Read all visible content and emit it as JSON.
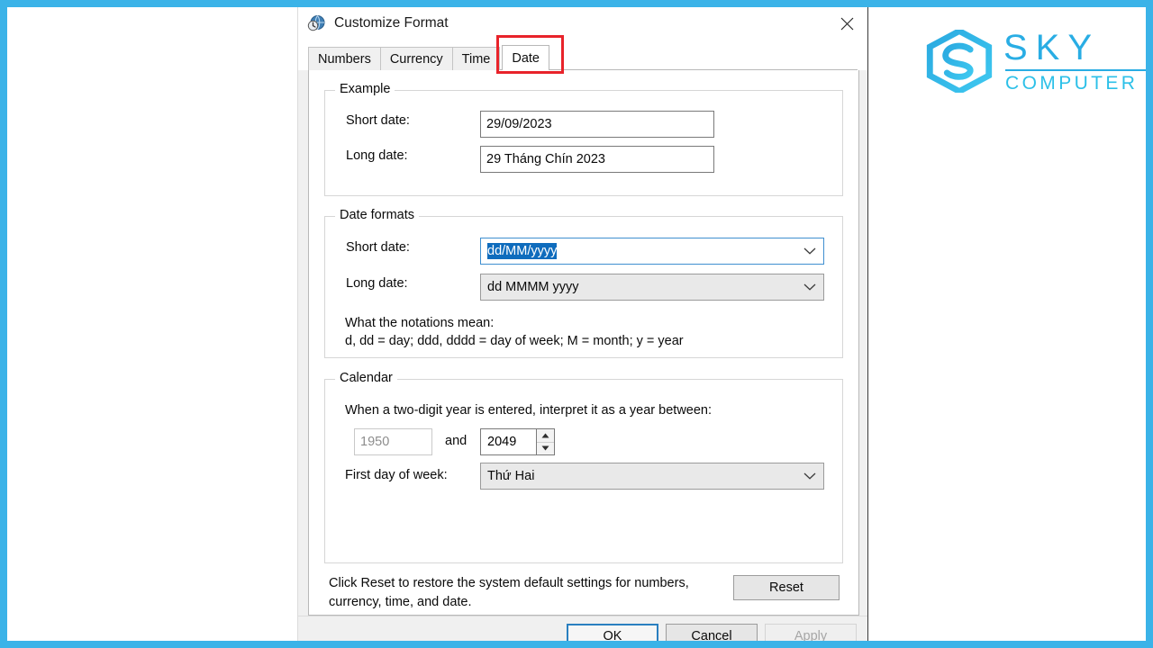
{
  "frame": {
    "accent_color": "#3bb3e8"
  },
  "logo": {
    "brand_top": "SKY",
    "brand_bottom": "COMPUTER",
    "color_primary": "#29ade4",
    "color_secondary": "#2cc0e8"
  },
  "dialog": {
    "title": "Customize Format",
    "icon": "region-globe-clock-icon",
    "close_label": "✕",
    "tabs": [
      {
        "label": "Numbers",
        "active": false
      },
      {
        "label": "Currency",
        "active": false
      },
      {
        "label": "Time",
        "active": false
      },
      {
        "label": "Date",
        "active": true,
        "highlight_color": "#e8232a"
      }
    ]
  },
  "example": {
    "group_title": "Example",
    "short_date_label": "Short date:",
    "short_date_value": "29/09/2023",
    "long_date_label": "Long date:",
    "long_date_value": "29 Tháng Chín 2023"
  },
  "date_formats": {
    "group_title": "Date formats",
    "short_date_label": "Short date:",
    "short_date_value": "dd/MM/yyyy",
    "short_date_selected": true,
    "long_date_label": "Long date:",
    "long_date_value": "dd MMMM yyyy",
    "notations_heading": "What the notations mean:",
    "notations_line": "d, dd = day;  ddd, dddd = day of week;  M = month;  y = year"
  },
  "calendar": {
    "group_title": "Calendar",
    "two_digit_label": "When a two-digit year is entered, interpret it as a year between:",
    "year_from": "1950",
    "and_label": "and",
    "year_to": "2049",
    "first_day_label": "First day of week:",
    "first_day_value": "Thứ Hai"
  },
  "reset": {
    "description": "Click Reset to restore the system default settings for numbers, currency, time, and date.",
    "button_label": "Reset"
  },
  "footer": {
    "ok_label": "OK",
    "cancel_label": "Cancel",
    "apply_label": "Apply"
  }
}
